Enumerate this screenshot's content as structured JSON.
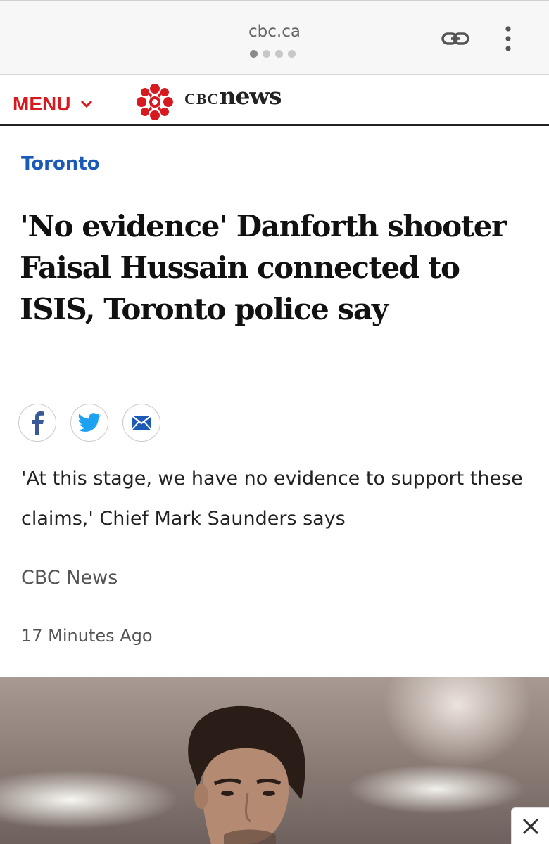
{
  "browser": {
    "url": "cbc.ca",
    "page_dots": 4,
    "active_dot": 1
  },
  "header": {
    "menu_label": "MENU",
    "brand_cbc": "CBC",
    "brand_news": "news",
    "accent_color": "#d71920"
  },
  "article": {
    "section": "Toronto",
    "headline": "'No evidence' Danforth shooter Faisal Hussain connected to ISIS, Toronto police say",
    "deck": "'At this stage, we have no evidence to support these claims,' Chief Mark Saunders says",
    "source": "CBC News",
    "timestamp": "17 Minutes Ago",
    "share_icons": [
      "facebook-icon",
      "twitter-icon",
      "email-icon"
    ]
  },
  "overlay": {
    "close_icon": "close-icon"
  }
}
